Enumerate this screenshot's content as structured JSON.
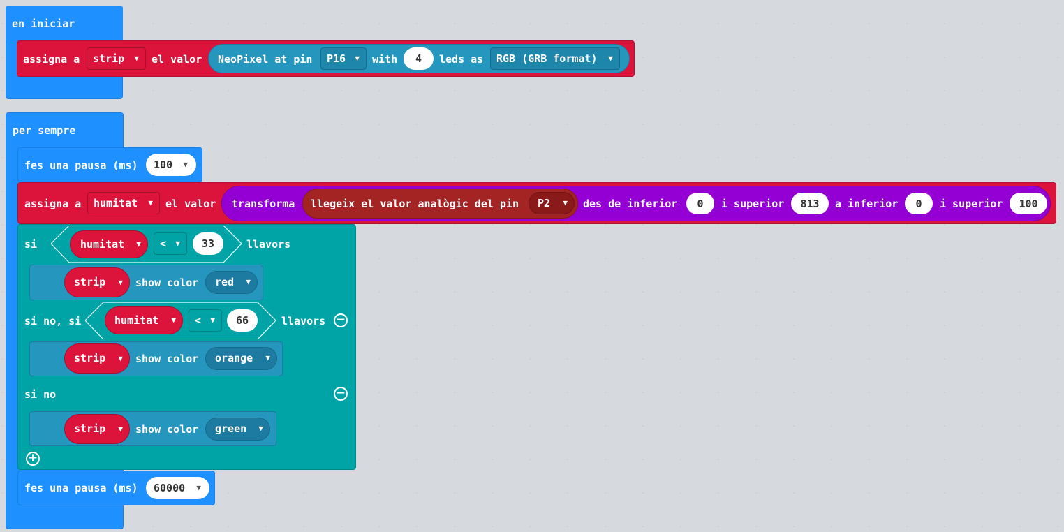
{
  "on_start": {
    "label": "en iniciar",
    "assign": {
      "prefix": "assigna a",
      "variable": "strip",
      "mid": "el valor",
      "neopixel": {
        "text1": "NeoPixel at pin",
        "pin": "P16",
        "text2": "with",
        "leds": "4",
        "text3": "leds as",
        "mode": "RGB (GRB format)"
      }
    }
  },
  "forever": {
    "label": "per sempre",
    "pause1": {
      "label": "fes una pausa (ms)",
      "value": "100"
    },
    "assign": {
      "prefix": "assigna a",
      "variable": "humitat",
      "mid": "el valor",
      "map": {
        "label": "transforma",
        "analog_read": {
          "label": "llegeix el valor analògic del pin",
          "pin": "P2"
        },
        "from_low_label": "des de inferior",
        "from_low": "0",
        "from_high_label": "i superior",
        "from_high": "813",
        "to_low_label": "a inferior",
        "to_low": "0",
        "to_high_label": "i superior",
        "to_high": "100"
      }
    },
    "if_block": {
      "if_label": "si",
      "cond1": {
        "variable": "humitat",
        "op": "<",
        "value": "33",
        "suffix": "llavors"
      },
      "then1": {
        "strip": "strip",
        "action": "show color",
        "color": "red"
      },
      "elseif_label": "si no, si",
      "cond2": {
        "variable": "humitat",
        "op": "<",
        "value": "66",
        "suffix": "llavors"
      },
      "then2": {
        "strip": "strip",
        "action": "show color",
        "color": "orange"
      },
      "else_label": "si no",
      "then3": {
        "strip": "strip",
        "action": "show color",
        "color": "green"
      }
    },
    "pause2": {
      "label": "fes una pausa (ms)",
      "value": "60000"
    }
  },
  "icons": {
    "minus": "minus-circle-icon",
    "plus": "plus-circle-icon",
    "caret": "caret-down-icon"
  },
  "colors": {
    "event": "#1e90ff",
    "variables": "#dc143c",
    "neopixel": "#2596be",
    "math": "#9400d3",
    "pins": "#a42323",
    "logic": "#00a4a6",
    "workspace": "#eceff1"
  }
}
